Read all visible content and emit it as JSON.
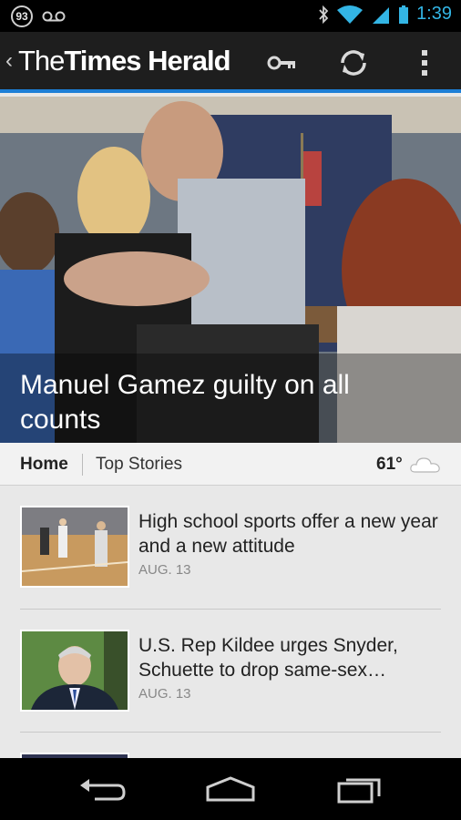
{
  "status_bar": {
    "notification_count": "93",
    "time": "1:39",
    "icons": [
      "voicemail-icon",
      "bluetooth-icon",
      "wifi-icon",
      "signal-icon",
      "battery-icon"
    ]
  },
  "app_bar": {
    "brand_prefix": "The",
    "brand_bold": "Times Herald",
    "icons": [
      "back-chevron-icon",
      "key-icon",
      "refresh-icon",
      "overflow-menu-icon"
    ],
    "accent": "#1d7fd6"
  },
  "hero": {
    "headline": "Manuel Gamez guilty on all counts"
  },
  "sections": {
    "home_label": "Home",
    "top_stories_label": "Top Stories",
    "temperature": "61°",
    "weather_icon": "cloud-icon"
  },
  "articles": [
    {
      "headline": "High school sports offer a new year and a new attitude",
      "date": "AUG. 13"
    },
    {
      "headline": "U.S. Rep Kildee urges Snyder, Schuette to drop same-sex…",
      "date": "AUG. 13"
    }
  ],
  "nav_bar": {
    "icons": [
      "back-icon",
      "home-icon",
      "recent-apps-icon"
    ]
  }
}
